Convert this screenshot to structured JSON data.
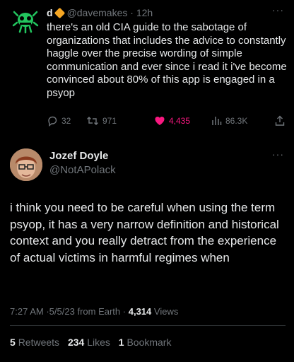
{
  "tweet_quoted": {
    "author_name": "d",
    "handle": "@davemakes",
    "separator": "·",
    "time": "12h",
    "text": "there's an old CIA guide to the sabotage of organizations that includes the advice to constantly haggle over the precise wording of simple communication and ever since i read it i've become convinced about 80% of this app is engaged in a psyop",
    "replies": "32",
    "retweets": "971",
    "likes": "4,435",
    "views": "86.3K",
    "colors": {
      "like": "#f91880",
      "badge": "#f5a623",
      "avatar_glyph": "#22c55e"
    }
  },
  "tweet_main": {
    "author_name": "Jozef Doyle",
    "handle": "@NotAPolack",
    "text": "i think you need to be careful when using the term psyop, it has a very narrow definition and historical context and you really detract from the experience of actual victims in harmful regimes when",
    "time": "7:27 AM",
    "dot1": "·",
    "date": "5/5/23",
    "source": "from Earth",
    "dot2": "·",
    "views_count": "4,314",
    "views_label": "Views",
    "retweets_count": "5",
    "retweets_label": "Retweets",
    "likes_count": "234",
    "likes_label": "Likes",
    "bookmarks_count": "1",
    "bookmarks_label": "Bookmark"
  },
  "icons": {
    "more": "more-icon",
    "reply": "reply-icon",
    "retweet": "retweet-icon",
    "like": "heart-icon",
    "views": "views-icon",
    "share": "share-icon"
  },
  "more_glyph": "···"
}
